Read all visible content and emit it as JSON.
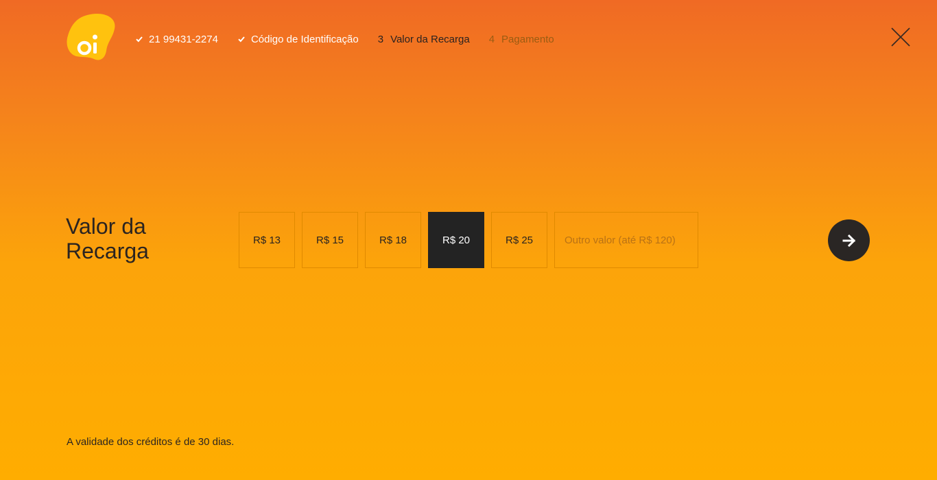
{
  "brand": {
    "logo_text": "oi",
    "logo_color": "#ffc20e"
  },
  "steps": [
    {
      "status": "done",
      "label": "21 99431-2274"
    },
    {
      "status": "done",
      "label": "Código de Identificação"
    },
    {
      "status": "current",
      "number": "3",
      "label": "Valor da Recarga"
    },
    {
      "status": "pending",
      "number": "4",
      "label": "Pagamento"
    }
  ],
  "main": {
    "heading_line1": "Valor da",
    "heading_line2": "Recarga",
    "options": [
      {
        "label": "R$ 13",
        "selected": false
      },
      {
        "label": "R$ 15",
        "selected": false
      },
      {
        "label": "R$ 18",
        "selected": false
      },
      {
        "label": "R$ 20",
        "selected": true
      },
      {
        "label": "R$ 25",
        "selected": false
      }
    ],
    "other_value": "",
    "other_placeholder": "Outro valor (até R$ 120)"
  },
  "footer": {
    "note": "A validade dos créditos é de 30 dias."
  },
  "colors": {
    "background_top": "#f06a24",
    "background_bottom": "#ffad00",
    "selected_bg": "#232323",
    "next_button_bg": "#2a2624"
  }
}
